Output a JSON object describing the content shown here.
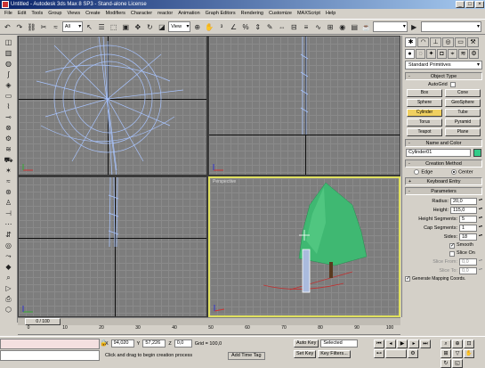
{
  "window": {
    "title": "Untitled - Autodesk 3ds Max 8 SP3 - Stand-alone License",
    "controls": [
      "_",
      "□",
      "×"
    ]
  },
  "menu": [
    "File",
    "Edit",
    "Tools",
    "Group",
    "Views",
    "Create",
    "Modifiers",
    "Character",
    "reactor",
    "Animation",
    "Graph Editors",
    "Rendering",
    "Customize",
    "MAXScript",
    "Help"
  ],
  "toolbar": {
    "selection_filter": "All",
    "reference_coord": "View"
  },
  "viewports": {
    "perspective_label": "Perspective"
  },
  "command_panel": {
    "category": "Standard Primitives",
    "object_type": {
      "title": "Object Type",
      "autogrid": "AutoGrid",
      "buttons": [
        "Box",
        "Cone",
        "Sphere",
        "GeoSphere",
        "Cylinder",
        "Tube",
        "Torus",
        "Pyramid",
        "Teapot",
        "Plane"
      ],
      "selected": "Cylinder"
    },
    "name_color": {
      "title": "Name and Color",
      "name": "Cylinder01"
    },
    "creation_method": {
      "title": "Creation Method",
      "edge": "Edge",
      "center": "Center"
    },
    "keyboard_entry": "Keyboard Entry",
    "parameters": {
      "title": "Parameters",
      "radius_label": "Radius:",
      "radius": "20,0",
      "height_label": "Height:",
      "height": "115,0",
      "height_segments_label": "Height Segments:",
      "height_segments": "5",
      "cap_segments_label": "Cap Segments:",
      "cap_segments": "1",
      "sides_label": "Sides:",
      "sides": "18",
      "smooth": "Smooth",
      "slice_on": "Slice On",
      "slice_from_label": "Slice From:",
      "slice_from": "0,0",
      "slice_to_label": "Slice To:",
      "slice_to": "0,0",
      "mapping": "Generate Mapping Coords."
    }
  },
  "timeline": {
    "frame_counter": "0 / 100",
    "ticks": [
      "0",
      "10",
      "20",
      "30",
      "40",
      "50",
      "60",
      "70",
      "80",
      "90",
      "100"
    ]
  },
  "status": {
    "x_label": "X",
    "x_value": "94,020",
    "y_label": "Y",
    "y_value": "57,226",
    "z_label": "Z",
    "z_value": "0,0",
    "grid": "Grid = 100,0",
    "prompt": "Click and drag to begin creation process",
    "add_time_tag": "Add Time Tag",
    "auto_key": "Auto Key",
    "set_key": "Set Key",
    "key_mode": "Selected",
    "key_filters": "Key Filters..."
  },
  "colors": {
    "active_viewport_border": "#e0e060",
    "selected_button": "#f0d060",
    "wire_color": "#33cc88",
    "viewport_bg": "#7d7d7d"
  }
}
